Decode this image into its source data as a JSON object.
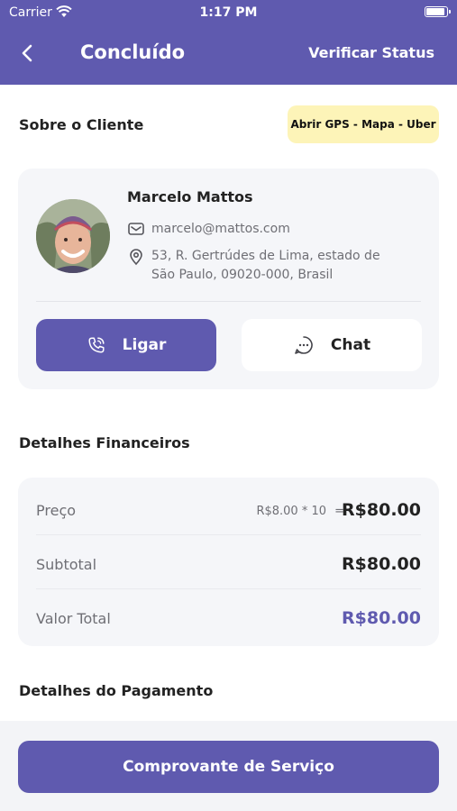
{
  "status_bar": {
    "carrier": "Carrier",
    "time": "1:17 PM",
    "battery_level": 0.95
  },
  "header": {
    "title": "Concluído",
    "action_label": "Verificar Status"
  },
  "client_section": {
    "title": "Sobre o Cliente",
    "gps_button": "Abrir GPS - Mapa - Uber",
    "name": "Marcelo Mattos",
    "email": "marcelo@mattos.com",
    "address_line1": "53, R. Gertrúdes de Lima, estado de",
    "address_line2": "São Paulo, 09020-000, Brasil",
    "call_label": "Ligar",
    "chat_label": "Chat"
  },
  "financial_section": {
    "title": "Detalhes Financeiros",
    "price_label": "Preço",
    "price_calc": "R$8.00 * 10",
    "price_eq": "=",
    "price_value": "R$80.00",
    "subtotal_label": "Subtotal",
    "subtotal_value": "R$80.00",
    "total_label": "Valor Total",
    "total_value": "R$80.00"
  },
  "payment_section": {
    "title": "Detalhes do Pagamento"
  },
  "footer": {
    "button_label": "Comprovante de Serviço"
  },
  "colors": {
    "primary": "#5f5aaf",
    "gps_button_bg": "#fdf4b8",
    "card_bg": "#f5f6f9"
  }
}
